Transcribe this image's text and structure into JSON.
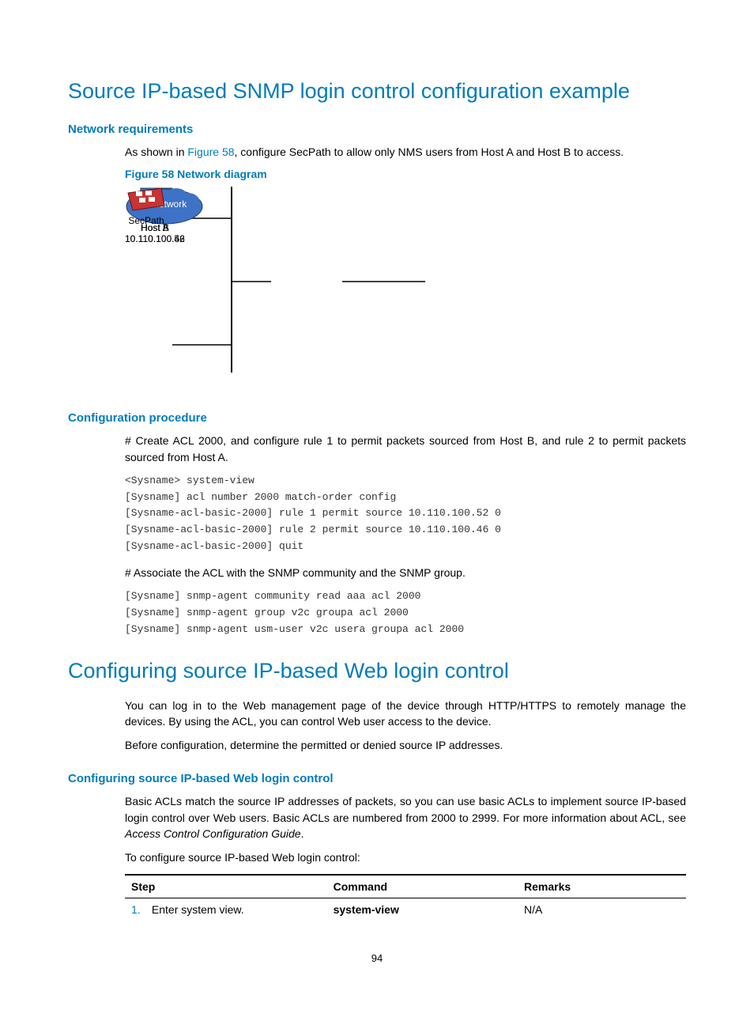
{
  "h1_a": "Source IP-based SNMP login control configuration example",
  "sec1": {
    "req_heading": "Network requirements",
    "req_text_a": "As shown in ",
    "req_link": "Figure 58",
    "req_text_b": ", configure SecPath to allow only NMS users from Host A and Host B to access.",
    "fig_caption": "Figure 58 Network diagram",
    "diagram": {
      "hostA_name": "Host A",
      "hostA_ip": "10.110.100.46",
      "hostB_name": "Host B",
      "hostB_ip": "10.110.100.52",
      "cloud_label": "IP network",
      "device_label": "SecPath"
    }
  },
  "sec2": {
    "heading": "Configuration procedure",
    "p1": "# Create ACL 2000, and configure rule 1 to permit packets sourced from Host B, and rule 2 to permit packets sourced from Host A.",
    "code1": "<Sysname> system-view\n[Sysname] acl number 2000 match-order config\n[Sysname-acl-basic-2000] rule 1 permit source 10.110.100.52 0\n[Sysname-acl-basic-2000] rule 2 permit source 10.110.100.46 0\n[Sysname-acl-basic-2000] quit",
    "p2": "# Associate the ACL with the SNMP community and the SNMP group.",
    "code2": "[Sysname] snmp-agent community read aaa acl 2000\n[Sysname] snmp-agent group v2c groupa acl 2000\n[Sysname] snmp-agent usm-user v2c usera groupa acl 2000"
  },
  "h1_b": "Configuring source IP-based Web login control",
  "sec3": {
    "p1": "You can log in to the Web management page of the device through HTTP/HTTPS to remotely manage the devices. By using the ACL, you can control Web user access to the device.",
    "p2": "Before configuration, determine the permitted or denied source IP addresses.",
    "heading": "Configuring source IP-based Web login control",
    "p3a": "Basic ACLs match the source IP addresses of packets, so you can use basic ACLs to implement source IP-based login control over Web users. Basic ACLs are numbered from 2000 to 2999. For more information about ACL, see ",
    "p3b": "Access Control Configuration Guide",
    "p3c": ".",
    "p4": "To configure source IP-based Web login control:"
  },
  "table": {
    "headers": {
      "c1": "Step",
      "c2": "Command",
      "c3": "Remarks"
    },
    "rows": [
      {
        "num": "1.",
        "step": "Enter system view.",
        "cmd": "system-view",
        "remarks": "N/A"
      }
    ]
  },
  "page_number": "94"
}
